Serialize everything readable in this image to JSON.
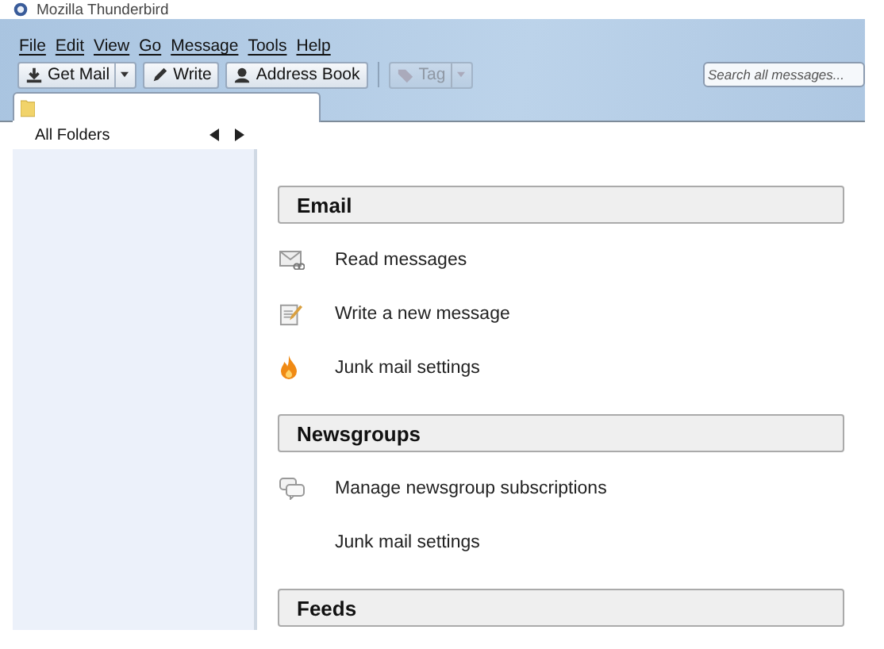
{
  "window": {
    "title": "Mozilla Thunderbird"
  },
  "menu": [
    "File",
    "Edit",
    "View",
    "Go",
    "Message",
    "Tools",
    "Help"
  ],
  "toolbar": [
    {
      "kind": "getmail",
      "label": "Get Mail",
      "has_menu": true,
      "disabled": false
    },
    {
      "kind": "write",
      "label": "Write",
      "has_menu": false,
      "disabled": false
    },
    {
      "kind": "addressbook",
      "label": "Address Book",
      "has_menu": false,
      "disabled": false
    },
    {
      "kind": "tag",
      "label": "Tag",
      "has_menu": true,
      "disabled": true
    }
  ],
  "search": {
    "placeholder": "Search all messages..."
  },
  "tabs": [
    {
      "kind": "folder",
      "selected": true
    }
  ],
  "sidebar": {
    "title": "All Folders"
  },
  "sections": [
    {
      "title": "Email",
      "items": [
        {
          "kind": "mail",
          "label": "Read messages"
        },
        {
          "kind": "compose",
          "label": "Write a new message"
        },
        {
          "kind": "junk",
          "label": "Junk mail settings"
        }
      ]
    },
    {
      "title": "Newsgroups",
      "items": [
        {
          "kind": "news",
          "label": "Manage newsgroup subscriptions"
        },
        {
          "kind": "plain",
          "label": "Junk mail settings"
        }
      ]
    },
    {
      "title": "Feeds"
    }
  ]
}
